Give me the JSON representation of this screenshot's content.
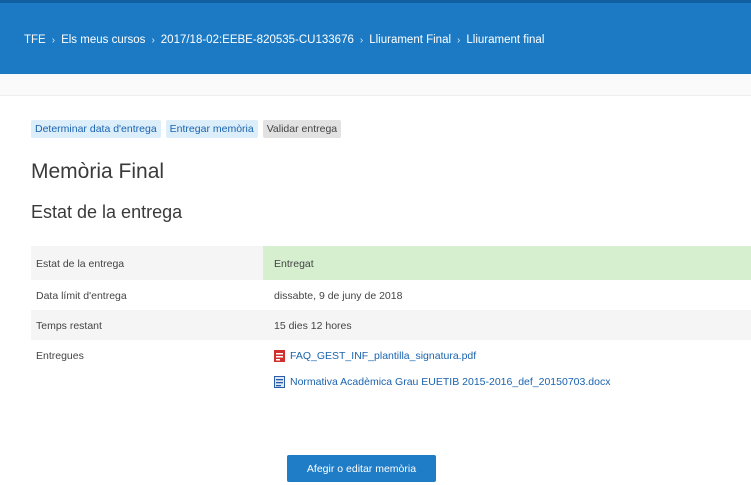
{
  "breadcrumb": [
    "TFE",
    "Els meus cursos",
    "2017/18-02:EEBE-820535-CU133676",
    "Lliurament Final",
    "Lliurament final"
  ],
  "step_nav": [
    {
      "label": "Determinar data d'entrega"
    },
    {
      "label": "Entregar memòria"
    },
    {
      "label": "Validar entrega"
    }
  ],
  "page_title": "Memòria Final",
  "section_title": "Estat de la entrega",
  "status_table": {
    "rows": [
      {
        "label": "Estat de la entrega",
        "value": "Entregat"
      },
      {
        "label": "Data límit d'entrega",
        "value": "dissabte, 9 de juny de 2018"
      },
      {
        "label": "Temps restant",
        "value": "15 dies 12 hores"
      },
      {
        "label": "Entregues"
      }
    ],
    "files": [
      {
        "name": "FAQ_GEST_INF_plantilla_signatura.pdf",
        "icon": "pdf-icon"
      },
      {
        "name": "Normativa Acadèmica Grau EUETIB 2015-2016_def_20150703.docx",
        "icon": "docx-icon"
      }
    ]
  },
  "primary_button": "Afegir o editar memòria",
  "colors": {
    "header": "#1c7ac4",
    "status_ok": "#d5efcf",
    "link": "#1a63b0",
    "button": "#1f7cc6"
  }
}
